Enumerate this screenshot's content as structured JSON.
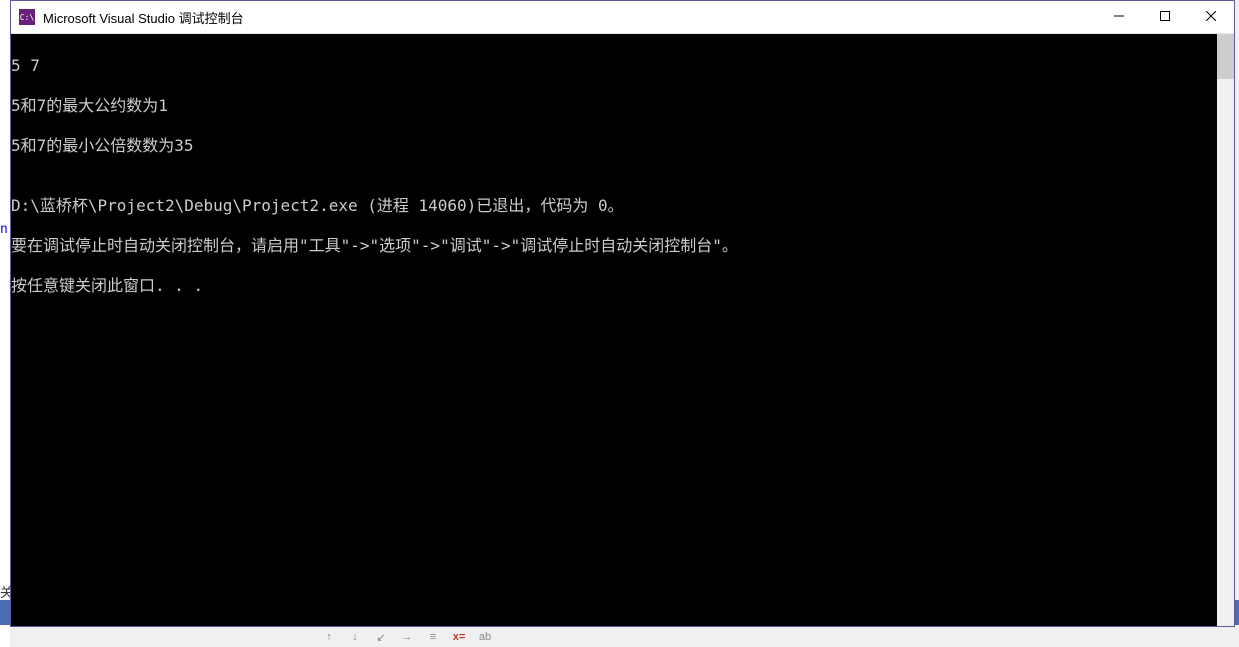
{
  "titlebar": {
    "icon_text": "C:\\",
    "title": "Microsoft Visual Studio 调试控制台"
  },
  "console": {
    "lines": [
      "5 7",
      "5和7的最大公约数为1",
      "5和7的最小公倍数数为35",
      "",
      "D:\\蓝桥杯\\Project2\\Debug\\Project2.exe (进程 14060)已退出，代码为 0。",
      "要在调试停止时自动关闭控制台，请启用\"工具\"->\"选项\"->\"调试\"->\"调试停止时自动关闭控制台\"。",
      "按任意键关闭此窗口. . ."
    ]
  },
  "background": {
    "left_char": "n",
    "bottom_char": "关",
    "toolbar_items": [
      "↑",
      "↓",
      "↙",
      "→",
      "≡",
      "x=",
      "ab"
    ]
  }
}
